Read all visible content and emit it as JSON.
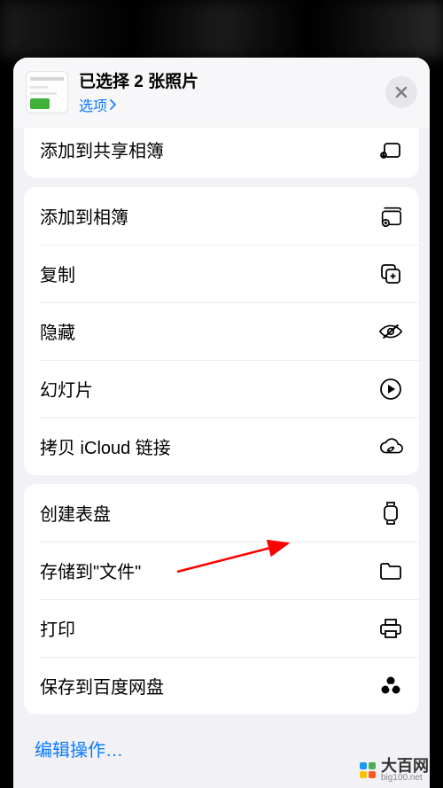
{
  "header": {
    "title": "已选择 2 张照片",
    "options_label": "选项"
  },
  "groups": [
    {
      "rows": [
        {
          "label": "添加到共享相簿",
          "icon": "shared-album-icon"
        }
      ],
      "partial_top": true
    },
    {
      "rows": [
        {
          "label": "添加到相簿",
          "icon": "add-album-icon"
        },
        {
          "label": "复制",
          "icon": "copy-icon"
        },
        {
          "label": "隐藏",
          "icon": "hide-icon"
        },
        {
          "label": "幻灯片",
          "icon": "play-icon"
        },
        {
          "label": "拷贝 iCloud 链接",
          "icon": "link-cloud-icon"
        }
      ]
    },
    {
      "rows": [
        {
          "label": "创建表盘",
          "icon": "watch-icon"
        },
        {
          "label": "存储到\"文件\"",
          "icon": "folder-icon",
          "pointed": true
        },
        {
          "label": "打印",
          "icon": "print-icon"
        },
        {
          "label": "保存到百度网盘",
          "icon": "baidu-icon"
        }
      ]
    }
  ],
  "edit_actions_label": "编辑操作…",
  "watermark": {
    "main": "大百网",
    "sub": "big100.net"
  }
}
